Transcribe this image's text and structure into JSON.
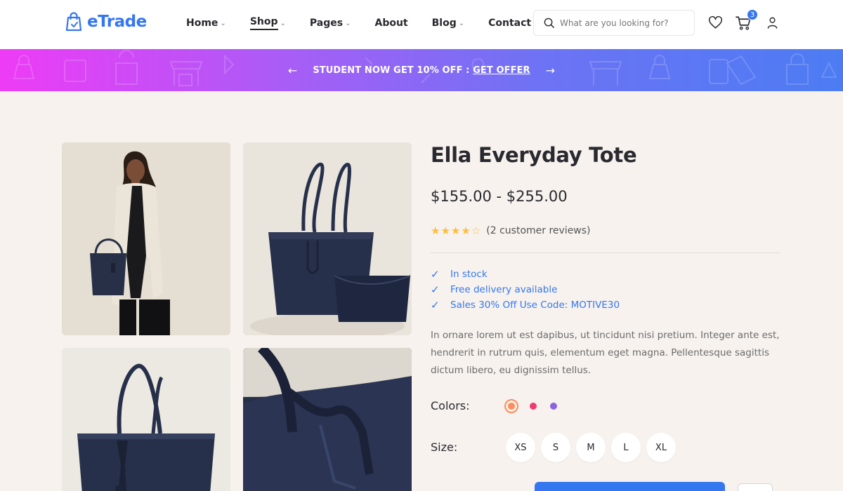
{
  "brand": {
    "logo_text": "eTrade",
    "accent": "#3577f0"
  },
  "nav": {
    "items": [
      {
        "label": "Home",
        "has_dropdown": true,
        "active": false
      },
      {
        "label": "Shop",
        "has_dropdown": true,
        "active": true
      },
      {
        "label": "Pages",
        "has_dropdown": true,
        "active": false
      },
      {
        "label": "About",
        "has_dropdown": false,
        "active": false
      },
      {
        "label": "Blog",
        "has_dropdown": true,
        "active": false
      },
      {
        "label": "Contact",
        "has_dropdown": false,
        "active": false
      }
    ]
  },
  "search": {
    "placeholder": "What are you looking for?"
  },
  "header_icons": {
    "wishlist": "heart-icon",
    "cart": "cart-icon",
    "account": "user-icon",
    "cart_count": "3"
  },
  "promo": {
    "text": "STUDENT NOW GET 10% OFF : ",
    "link": "GET OFFER",
    "prev_icon": "arrow-left-icon",
    "next_icon": "arrow-right-icon"
  },
  "product": {
    "title": "Ella Everyday Tote",
    "price": "$155.00 - $255.00",
    "rating": 4,
    "rating_max": 5,
    "reviews": "(2 customer reviews)",
    "features": [
      "In stock",
      "Free delivery available",
      "Sales 30% Off Use Code: MOTIVE30"
    ],
    "description": "In ornare lorem ut est dapibus, ut tincidunt nisi pretium. Integer ante est, hendrerit in rutrum quis, elementum eget magna. Pellentesque sagittis dictum libero, eu dignissim tellus.",
    "colors_label": "Colors:",
    "colors": [
      "#ff8c5a",
      "#f23a72",
      "#8b63e0"
    ],
    "selected_color": 0,
    "size_label": "Size:",
    "sizes": [
      "XS",
      "S",
      "M",
      "L",
      "XL"
    ]
  },
  "gallery": {
    "images": [
      "model-with-tote-image",
      "tote-with-pouch-image",
      "tote-front-image",
      "tote-detail-closeup-image"
    ]
  }
}
